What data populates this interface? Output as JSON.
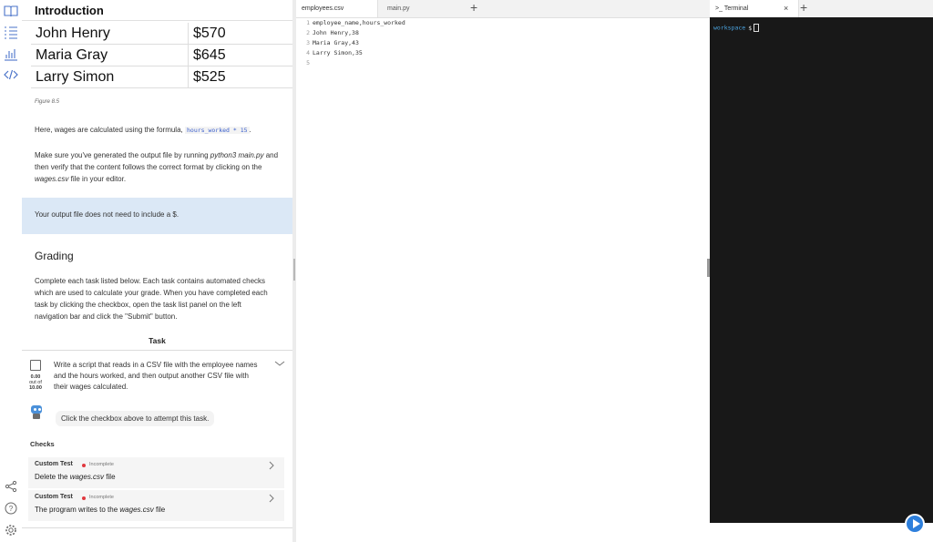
{
  "guide": {
    "title": "Introduction",
    "wages_table": [
      {
        "name": "John Henry",
        "amount": "$570"
      },
      {
        "name": "Maria Gray",
        "amount": "$645"
      },
      {
        "name": "Larry Simon",
        "amount": "$525"
      }
    ],
    "figure_caption": "Figure 8.5",
    "formula_text_before": "Here, wages are calculated using the formula,",
    "formula_code": "hours_worked * 15",
    "formula_text_after": ".",
    "instructions_1": "Make sure you've generated the output file by running",
    "instructions_cmd": "python3 main.py",
    "instructions_2": "and then verify that the content follows the correct format by clicking on the",
    "instructions_file": "wages.csv",
    "instructions_3": "file in your editor.",
    "info_text": "Your output file does not need to include a $.",
    "grading_heading": "Grading",
    "grading_text": "Complete each task listed below. Each task contains automated checks which are used to calculate your grade. When you have completed each task by clicking the checkbox, open the task list panel on the left navigation bar and click the \"Submit\" button.",
    "task_heading": "Task",
    "task": {
      "description": "Write a script that reads in a CSV file with the employee names and the hours worked, and then output another CSV file with their wages calculated.",
      "score": "0.00",
      "score_of": "out of",
      "score_total": "10.00",
      "hint": "Click the checkbox above to attempt this task."
    },
    "checks_heading": "Checks",
    "checks": [
      {
        "title": "Custom Test",
        "status": "Incomplete",
        "desc_before": "Delete the",
        "desc_file": "wages.csv",
        "desc_after": "file"
      },
      {
        "title": "Custom Test",
        "status": "Incomplete",
        "desc_before": "The program writes to the",
        "desc_file": "wages.csv",
        "desc_after": "file"
      }
    ]
  },
  "editor": {
    "tabs": [
      {
        "label": "employees.csv",
        "active": true
      },
      {
        "label": "main.py",
        "active": false
      }
    ],
    "add_tab": "+",
    "lines": [
      {
        "n": "1",
        "text": "employee_name,hours_worked"
      },
      {
        "n": "2",
        "text": "John Henry,38"
      },
      {
        "n": "3",
        "text": "Maria Gray,43"
      },
      {
        "n": "4",
        "text": "Larry Simon,35"
      },
      {
        "n": "5",
        "text": ""
      }
    ]
  },
  "terminal": {
    "tab_label": "Terminal",
    "tab_icon": ">_",
    "close": "×",
    "add_tab": "+",
    "prompt_dir": "workspace",
    "prompt_symbol": "$"
  },
  "colors": {
    "accent": "#4a73c9",
    "info_bg": "#dbe8f6",
    "terminal_bg": "#181818",
    "incomplete": "#e0383e",
    "play": "#2d7fdc"
  },
  "icons": {
    "rail_top": [
      "book-icon",
      "list-icon",
      "chart-icon",
      "code-icon"
    ],
    "rail_bottom": [
      "share-icon",
      "help-icon",
      "settings-icon"
    ]
  }
}
